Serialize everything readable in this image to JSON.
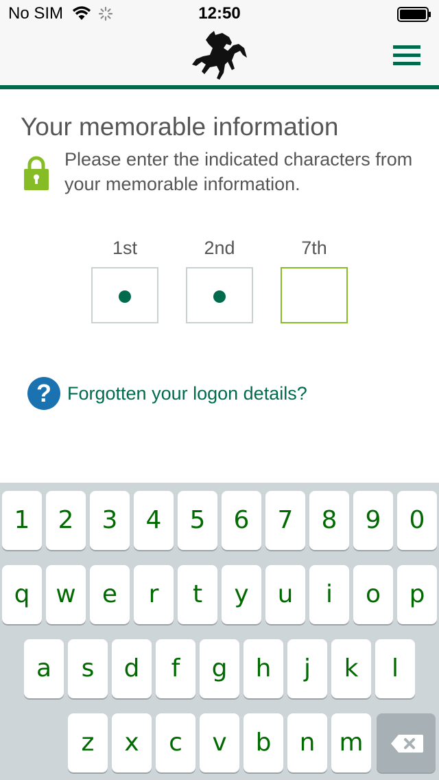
{
  "status_bar": {
    "carrier": "No SIM",
    "time": "12:50"
  },
  "header": {
    "logo_icon": "black-horse-logo-icon",
    "menu_icon": "hamburger-menu-icon"
  },
  "content": {
    "title": "Your memorable information",
    "instructions": "Please enter the indicated characters from your memorable information.",
    "characters": [
      {
        "label": "1st",
        "filled": true
      },
      {
        "label": "2nd",
        "filled": true
      },
      {
        "label": "7th",
        "filled": false
      }
    ],
    "help_link": "Forgotten your logon details?",
    "help_icon_glyph": "?"
  },
  "keyboard": {
    "row1": [
      "1",
      "2",
      "3",
      "4",
      "5",
      "6",
      "7",
      "8",
      "9",
      "0"
    ],
    "row2": [
      "q",
      "w",
      "e",
      "r",
      "t",
      "y",
      "u",
      "i",
      "o",
      "p"
    ],
    "row3": [
      "a",
      "s",
      "d",
      "f",
      "g",
      "h",
      "j",
      "k",
      "l"
    ],
    "row4": [
      "z",
      "x",
      "c",
      "v",
      "b",
      "n",
      "m"
    ],
    "delete_icon": "backspace-icon"
  },
  "colors": {
    "brand_green": "#006a4d",
    "active_border": "#86bc25",
    "key_text": "#006a00",
    "help_blue": "#1a72b0"
  }
}
